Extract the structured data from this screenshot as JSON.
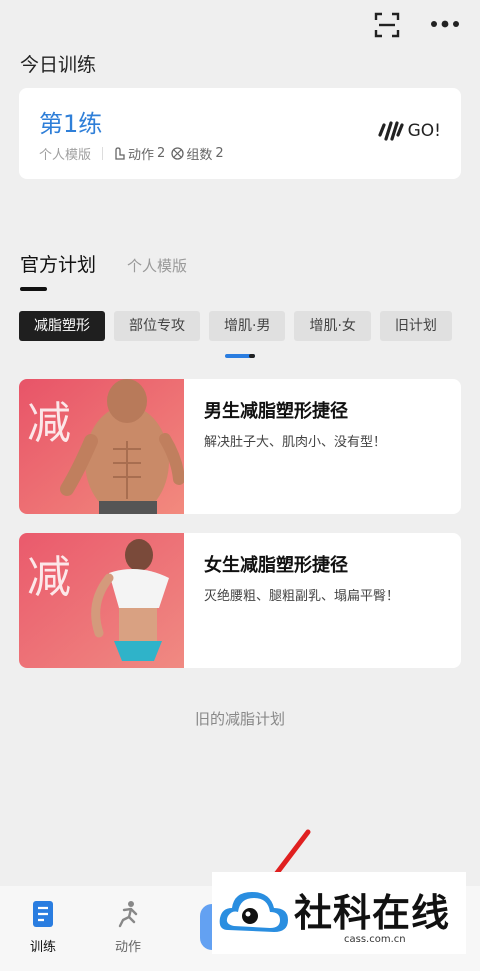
{
  "header": {
    "scan_icon": "scan-icon",
    "more_icon": "more-icon"
  },
  "today": {
    "title": "今日训练",
    "card": {
      "name": "第1练",
      "source": "个人模版",
      "actions_label": "动作",
      "actions_count": "2",
      "sets_label": "组数",
      "sets_count": "2",
      "go_label": "GO!"
    }
  },
  "tabs": {
    "active": "官方计划",
    "other": "个人模版"
  },
  "chips": [
    "减脂塑形",
    "部位专攻",
    "增肌·男",
    "增肌·女",
    "旧计划"
  ],
  "plans": [
    {
      "image_text": "减",
      "title": "男生减脂塑形捷径",
      "desc": "解决肚子大、肌肉小、没有型！"
    },
    {
      "image_text": "减",
      "title": "女生减脂塑形捷径",
      "desc": "灭绝腰粗、腿粗副乳、塌扁平臀！"
    }
  ],
  "old_plans_link": "旧的减脂计划",
  "nav": {
    "train_label": "训练",
    "action_label": "动作"
  },
  "watermark": {
    "text": "社科在线",
    "sub": "cass.com.cn"
  },
  "colors": {
    "accent": "#2f7fd8",
    "chip_active": "#1f1f1f",
    "plan_bg": "#ec5a6a"
  }
}
